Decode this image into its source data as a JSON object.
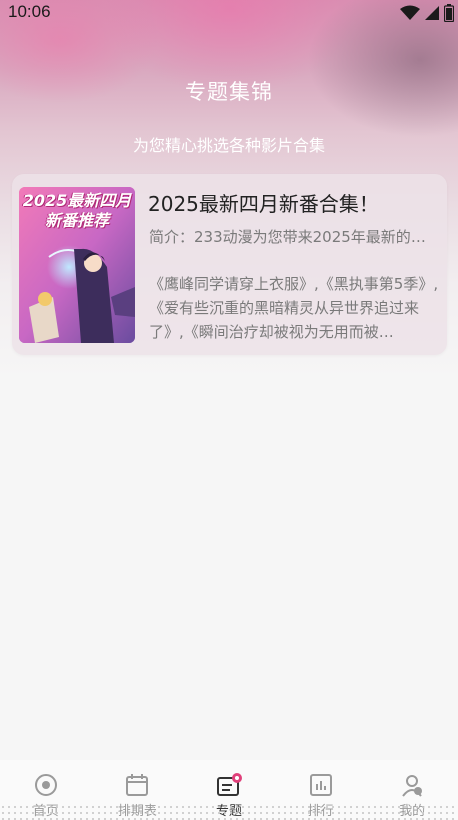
{
  "status_bar": {
    "time": "10:06",
    "icons": [
      "wifi-icon",
      "signal-icon",
      "battery-icon"
    ]
  },
  "header": {
    "title": "专题集锦",
    "subtitle": "为您精心挑选各种影片合集"
  },
  "collection": {
    "cover_text": "2025最新四月新番推荐",
    "title": "2025最新四月新番合集！",
    "description": "简介：233动漫为您带来2025年最新的动…",
    "works": "《鹰峰同学请穿上衣服》,《黑执事第5季》,《爱有些沉重的黑暗精灵从异世界追过来了》,《瞬间治疗却被视为无用而被…"
  },
  "tab_bar": {
    "tabs": [
      {
        "label": "首页",
        "icon": "home-icon",
        "active": false
      },
      {
        "label": "排期表",
        "icon": "calendar-icon",
        "active": false
      },
      {
        "label": "专题",
        "icon": "topic-icon",
        "active": true
      },
      {
        "label": "排行",
        "icon": "chart-icon",
        "active": false
      },
      {
        "label": "我的",
        "icon": "profile-icon",
        "active": false
      }
    ]
  },
  "colors": {
    "accent": "#e0407a",
    "hero_top": "#d98fb2",
    "card_bg": "#ece2e8"
  }
}
